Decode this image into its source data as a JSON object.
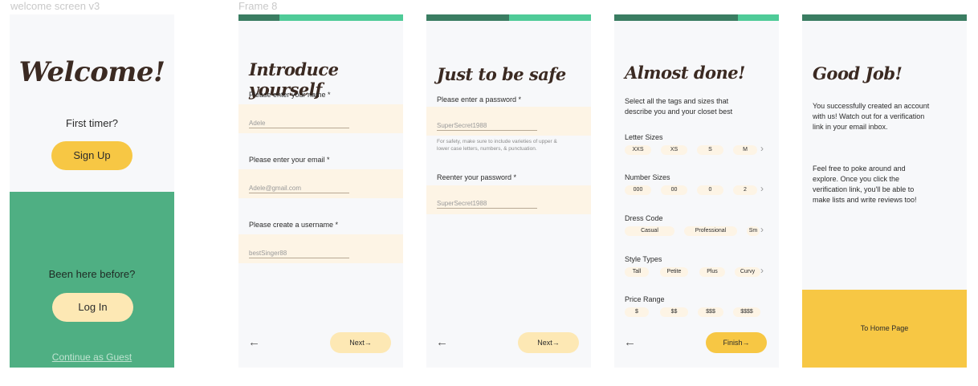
{
  "frames": {
    "welcome_label": "welcome screen v3",
    "frame8_label": "Frame 8"
  },
  "welcome": {
    "title": "Welcome!",
    "first_timer": "First timer?",
    "sign_up": "Sign Up",
    "been_here": "Been here before?",
    "log_in": "Log In",
    "guest": "Continue as Guest"
  },
  "introduce": {
    "progress": 0.25,
    "title": "Introduce yourself",
    "name_label": "Please enter your name *",
    "name_value": "Adele",
    "email_label": "Please enter your email *",
    "email_value": "Adele@gmail.com",
    "username_label": "Please create a username *",
    "username_value": "bestSinger88",
    "next": "Next",
    "next_arrow": "→",
    "back_arrow": "←"
  },
  "safe": {
    "progress": 0.5,
    "title": "Just to be safe",
    "password_label": "Please enter a password *",
    "password_value": "SuperSecret1988",
    "hint": "For safety, make sure to include varieties of upper & lower case letters, numbers, & punctuation.",
    "reenter_label": "Reenter your password *",
    "reenter_value": "SuperSecret1988",
    "next": "Next",
    "next_arrow": "→",
    "back_arrow": "←"
  },
  "almost": {
    "progress": 0.75,
    "title": "Almost done!",
    "desc": "Select all the tags and sizes that describe you and your closet best",
    "letter_sizes": {
      "label": "Letter Sizes",
      "tags": [
        "XXS",
        "XS",
        "S",
        "M"
      ]
    },
    "number_sizes": {
      "label": "Number Sizes",
      "tags": [
        "000",
        "00",
        "0",
        "2"
      ]
    },
    "dress_code": {
      "label": "Dress Code",
      "tags": [
        "Casual",
        "Professional",
        "Sm"
      ]
    },
    "style_types": {
      "label": "Style Types",
      "tags": [
        "Tall",
        "Petite",
        "Plus",
        "Curvy"
      ]
    },
    "price_range": {
      "label": "Price Range",
      "tags": [
        "$",
        "$$",
        "$$$",
        "$$$$"
      ]
    },
    "chevron": "›",
    "finish": "Finish",
    "finish_arrow": "→",
    "back_arrow": "←"
  },
  "goodjob": {
    "progress": 1.0,
    "title": "Good Job!",
    "para1": "You successfully created an account with us! Watch out for a verification link in your email inbox.",
    "para2": "Feel free to poke around and explore. Once you click the verification link, you'll be able to make lists and write reviews too!",
    "home": "To Home Page"
  },
  "colors": {
    "progress_dark": "#3a7d62",
    "progress_light": "#4fcb98",
    "green_band": "#4faf83",
    "yellow": "#f7c744",
    "cream": "#fdf4e5"
  }
}
